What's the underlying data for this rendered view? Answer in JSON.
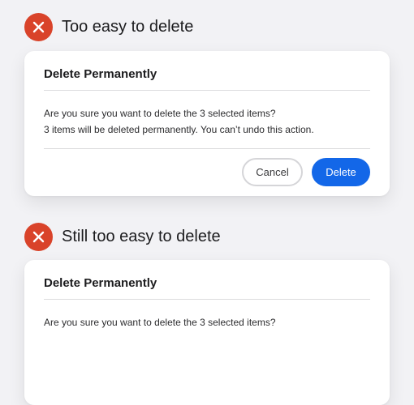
{
  "examples": [
    {
      "heading": "Too easy to delete",
      "icon": "close-x-icon",
      "dialog": {
        "title": "Delete Permanently",
        "message_line1": "Are you sure you want to delete the 3 selected items?",
        "message_line2": "3 items will be deleted permanently. You can’t undo this action.",
        "cancel_label": "Cancel",
        "delete_label": "Delete"
      }
    },
    {
      "heading": "Still too easy to delete",
      "icon": "close-x-icon",
      "dialog": {
        "title": "Delete Permanently",
        "message_line1": "Are you sure you want to delete the 3 selected items?"
      }
    }
  ],
  "colors": {
    "page_background": "#f2f2f5",
    "bad_icon": "#d9432a",
    "primary_button": "#1367e8",
    "cancel_border": "#d5d5d8"
  }
}
